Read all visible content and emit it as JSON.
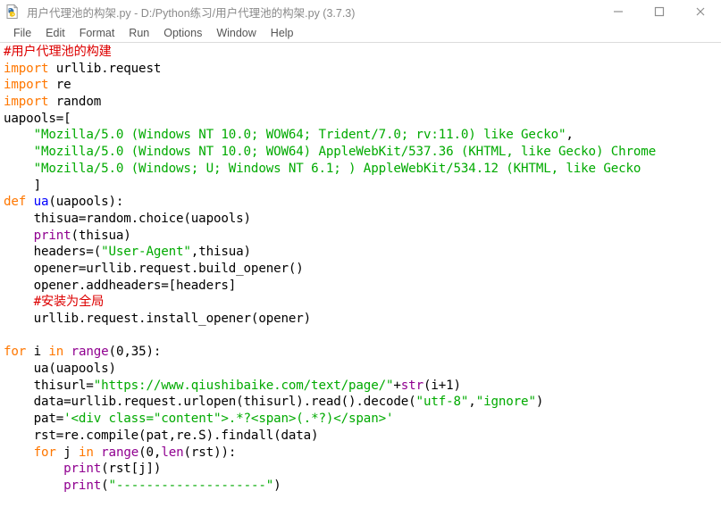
{
  "window": {
    "title": "用户代理池的构架.py - D:/Python练习/用户代理池的构架.py (3.7.3)",
    "app_icon": "python-idle-icon",
    "controls": {
      "minimize": "minimize-icon",
      "maximize": "maximize-icon",
      "close": "close-icon"
    }
  },
  "menubar": {
    "items": [
      {
        "label": "File"
      },
      {
        "label": "Edit"
      },
      {
        "label": "Format"
      },
      {
        "label": "Run"
      },
      {
        "label": "Options"
      },
      {
        "label": "Window"
      },
      {
        "label": "Help"
      }
    ]
  },
  "colors": {
    "comment": "#dd0000",
    "keyword": "#ff7700",
    "string": "#00aa00",
    "builtin": "#900090",
    "definition": "#0000ff",
    "text": "#000000",
    "background": "#ffffff",
    "chrome_text": "#555555",
    "title_text": "#8a8a8a"
  },
  "editor": {
    "lines": [
      [
        {
          "t": "#用户代理池的构建",
          "c": "comment"
        }
      ],
      [
        {
          "t": "import",
          "c": "keyword"
        },
        {
          "t": " urllib.request",
          "c": "plain"
        }
      ],
      [
        {
          "t": "import",
          "c": "keyword"
        },
        {
          "t": " re",
          "c": "plain"
        }
      ],
      [
        {
          "t": "import",
          "c": "keyword"
        },
        {
          "t": " random",
          "c": "plain"
        }
      ],
      [
        {
          "t": "uapools=[",
          "c": "plain"
        }
      ],
      [
        {
          "t": "    ",
          "c": "plain"
        },
        {
          "t": "\"Mozilla/5.0 (Windows NT 10.0; WOW64; Trident/7.0; rv:11.0) like Gecko\"",
          "c": "string"
        },
        {
          "t": ",",
          "c": "plain"
        }
      ],
      [
        {
          "t": "    ",
          "c": "plain"
        },
        {
          "t": "\"Mozilla/5.0 (Windows NT 10.0; WOW64) AppleWebKit/537.36 (KHTML, like Gecko) Chrome",
          "c": "string"
        }
      ],
      [
        {
          "t": "    ",
          "c": "plain"
        },
        {
          "t": "\"Mozilla/5.0 (Windows; U; Windows NT 6.1; ) AppleWebKit/534.12 (KHTML, like Gecko",
          "c": "string"
        }
      ],
      [
        {
          "t": "    ]",
          "c": "plain"
        }
      ],
      [
        {
          "t": "def",
          "c": "keyword"
        },
        {
          "t": " ",
          "c": "plain"
        },
        {
          "t": "ua",
          "c": "def"
        },
        {
          "t": "(uapools):",
          "c": "plain"
        }
      ],
      [
        {
          "t": "    thisua=random.choice(uapools)",
          "c": "plain"
        }
      ],
      [
        {
          "t": "    ",
          "c": "plain"
        },
        {
          "t": "print",
          "c": "builtin"
        },
        {
          "t": "(thisua)",
          "c": "plain"
        }
      ],
      [
        {
          "t": "    headers=(",
          "c": "plain"
        },
        {
          "t": "\"User-Agent\"",
          "c": "string"
        },
        {
          "t": ",thisua)",
          "c": "plain"
        }
      ],
      [
        {
          "t": "    opener=urllib.request.build_opener()",
          "c": "plain"
        }
      ],
      [
        {
          "t": "    opener.addheaders=[headers]",
          "c": "plain"
        }
      ],
      [
        {
          "t": "    ",
          "c": "plain"
        },
        {
          "t": "#安装为全局",
          "c": "comment"
        }
      ],
      [
        {
          "t": "    urllib.request.install_opener(opener)",
          "c": "plain"
        }
      ],
      [
        {
          "t": "",
          "c": "plain"
        }
      ],
      [
        {
          "t": "for",
          "c": "keyword"
        },
        {
          "t": " i ",
          "c": "plain"
        },
        {
          "t": "in",
          "c": "keyword"
        },
        {
          "t": " ",
          "c": "plain"
        },
        {
          "t": "range",
          "c": "builtin"
        },
        {
          "t": "(0,35):",
          "c": "plain"
        }
      ],
      [
        {
          "t": "    ua(uapools)",
          "c": "plain"
        }
      ],
      [
        {
          "t": "    thisurl=",
          "c": "plain"
        },
        {
          "t": "\"https://www.qiushibaike.com/text/page/\"",
          "c": "string"
        },
        {
          "t": "+",
          "c": "plain"
        },
        {
          "t": "str",
          "c": "builtin"
        },
        {
          "t": "(i+1)",
          "c": "plain"
        }
      ],
      [
        {
          "t": "    data=urllib.request.urlopen(thisurl).read().decode(",
          "c": "plain"
        },
        {
          "t": "\"utf-8\"",
          "c": "string"
        },
        {
          "t": ",",
          "c": "plain"
        },
        {
          "t": "\"ignore\"",
          "c": "string"
        },
        {
          "t": ")",
          "c": "plain"
        }
      ],
      [
        {
          "t": "    pat=",
          "c": "plain"
        },
        {
          "t": "'<div class=\"content\">.*?<span>(.*?)</span>'",
          "c": "string"
        }
      ],
      [
        {
          "t": "    rst=re.compile(pat,re.S).findall(data)",
          "c": "plain"
        }
      ],
      [
        {
          "t": "    ",
          "c": "plain"
        },
        {
          "t": "for",
          "c": "keyword"
        },
        {
          "t": " j ",
          "c": "plain"
        },
        {
          "t": "in",
          "c": "keyword"
        },
        {
          "t": " ",
          "c": "plain"
        },
        {
          "t": "range",
          "c": "builtin"
        },
        {
          "t": "(0,",
          "c": "plain"
        },
        {
          "t": "len",
          "c": "builtin"
        },
        {
          "t": "(rst)):",
          "c": "plain"
        }
      ],
      [
        {
          "t": "        ",
          "c": "plain"
        },
        {
          "t": "print",
          "c": "builtin"
        },
        {
          "t": "(rst[j])",
          "c": "plain"
        }
      ],
      [
        {
          "t": "        ",
          "c": "plain"
        },
        {
          "t": "print",
          "c": "builtin"
        },
        {
          "t": "(",
          "c": "plain"
        },
        {
          "t": "\"--------------------\"",
          "c": "string"
        },
        {
          "t": ")",
          "c": "plain"
        }
      ]
    ]
  }
}
